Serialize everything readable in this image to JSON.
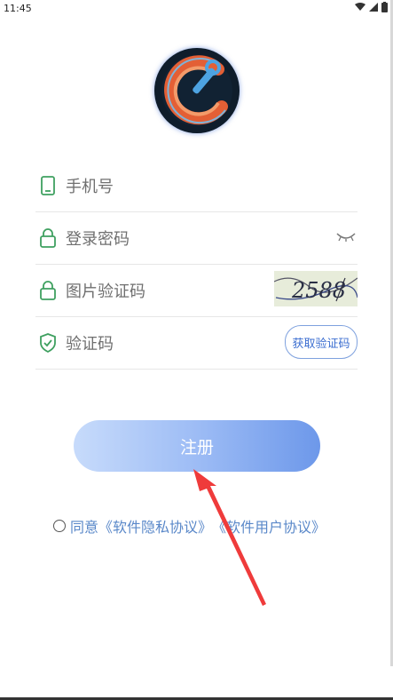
{
  "status_bar": {
    "time": "11:45"
  },
  "form": {
    "phone_placeholder": "手机号",
    "password_placeholder": "登录密码",
    "image_captcha_placeholder": "图片验证码",
    "sms_code_placeholder": "验证码",
    "get_code_button": "获取验证码",
    "captcha_text": "2588"
  },
  "register_button": "注册",
  "agreement": {
    "prefix": "同意",
    "privacy_link": "《软件隐私协议》",
    "user_link": "《软件用户协议》"
  },
  "colors": {
    "accent_green": "#3fa060",
    "link_blue": "#5a88c9",
    "annotation_arrow": "#ef3b3b"
  }
}
